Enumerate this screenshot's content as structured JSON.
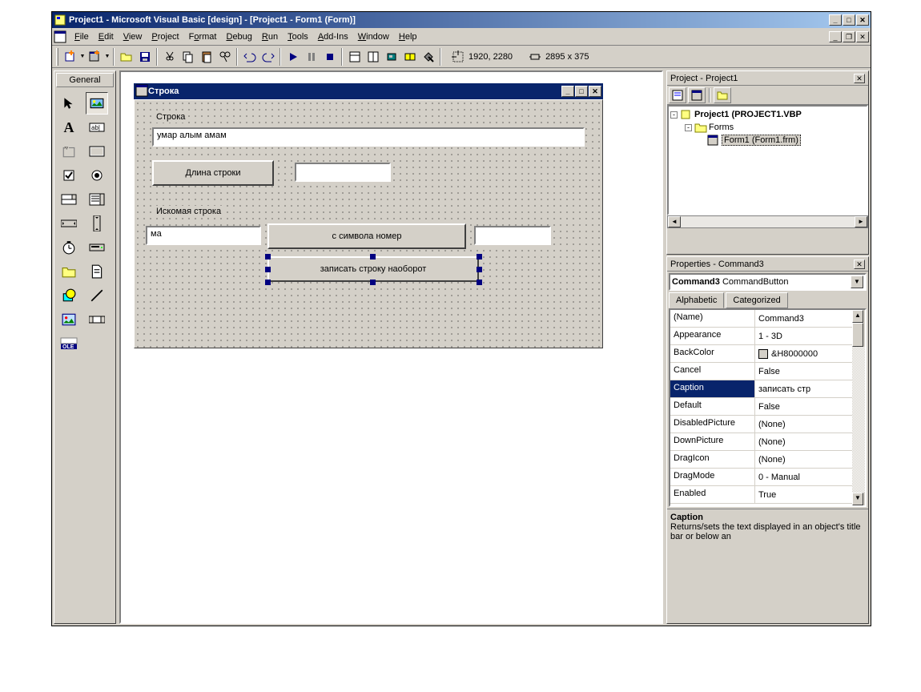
{
  "window": {
    "title": "Project1 - Microsoft Visual Basic [design] - [Project1 - Form1 (Form)]"
  },
  "menu": [
    "File",
    "Edit",
    "View",
    "Project",
    "Format",
    "Debug",
    "Run",
    "Tools",
    "Add-Ins",
    "Window",
    "Help"
  ],
  "status": {
    "coords": "1920, 2280",
    "size": "2895 x 375"
  },
  "toolbox": {
    "tab": "General"
  },
  "form": {
    "title": "Строка",
    "label1": "Строка",
    "text1": "умар алым амам",
    "btn1": "Длина строки",
    "text2": "",
    "label2": "Искомая строка",
    "text3": "ма",
    "btn2": "с символа номер",
    "text4": "",
    "btn3": "записать строку наоборот"
  },
  "project_panel": {
    "title": "Project - Project1",
    "root": "Project1 (PROJECT1.VBP",
    "forms": "Forms",
    "form_item": "Form1 (Form1.frm)"
  },
  "properties_panel": {
    "title": "Properties - Command3",
    "object_name": "Command3",
    "object_type": "CommandButton",
    "tabs": [
      "Alphabetic",
      "Categorized"
    ],
    "rows": [
      {
        "name": "(Name)",
        "value": "Command3"
      },
      {
        "name": "Appearance",
        "value": "1 - 3D"
      },
      {
        "name": "BackColor",
        "value": "&H8000000"
      },
      {
        "name": "Cancel",
        "value": "False"
      },
      {
        "name": "Caption",
        "value": "записать стр"
      },
      {
        "name": "Default",
        "value": "False"
      },
      {
        "name": "DisabledPicture",
        "value": "(None)"
      },
      {
        "name": "DownPicture",
        "value": "(None)"
      },
      {
        "name": "DragIcon",
        "value": "(None)"
      },
      {
        "name": "DragMode",
        "value": "0 - Manual"
      },
      {
        "name": "Enabled",
        "value": "True"
      }
    ],
    "desc_title": "Caption",
    "desc_text": "Returns/sets the text displayed in an object's title bar or below an"
  }
}
